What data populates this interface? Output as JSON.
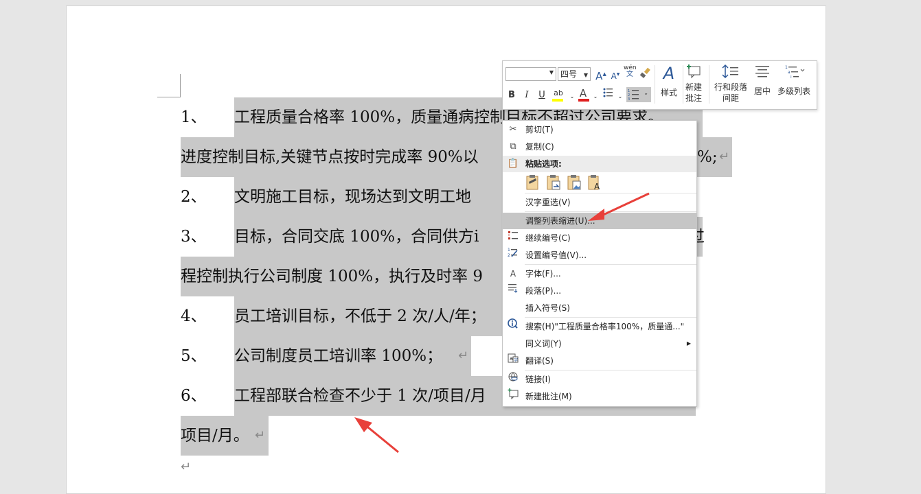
{
  "document": {
    "items": [
      {
        "num": "1、",
        "text": "工程质量合格率 100%，质量通病控制目标不超过公司要求。"
      },
      {
        "cont": "进度控制目标,关键节点按时完成率 90%以",
        "tail": "%;"
      },
      {
        "num": "2、",
        "text": "文明施工目标，现场达到文明工地"
      },
      {
        "num": "3、",
        "text": "目标，合同交底 100%，合同供方i",
        "tail": "过"
      },
      {
        "cont": "程控制执行公司制度 100%，执行及时率 9"
      },
      {
        "num": "4、",
        "text": "员工培训目标，不低于 2 次/人/年；"
      },
      {
        "num": "5、",
        "text": "公司制度员工培训率 100%；"
      },
      {
        "num": "6、",
        "text": "工程部联合检查不少于 1 次/项目/月"
      },
      {
        "cont": "项目/月。"
      }
    ],
    "para_mark": "↵"
  },
  "mini_toolbar": {
    "font_name": "",
    "font_size": "四号",
    "grow_font": "A",
    "shrink_font": "A",
    "phonetic_top": "wén",
    "phonetic_bottom": "文",
    "bold": "B",
    "italic": "I",
    "underline": "U",
    "highlight": "ab",
    "font_color": "A",
    "styles_label": "样式",
    "new_comment_label_1": "新建",
    "new_comment_label_2": "批注",
    "line_spacing_label_1": "行和段落",
    "line_spacing_label_2": "间距",
    "center_label": "居中",
    "multilevel_label": "多级列表"
  },
  "context_menu": {
    "cut": "剪切(T)",
    "copy": "复制(C)",
    "paste_options": "粘贴选项:",
    "hanzi_reselect": "汉字重选(V)",
    "adjust_list_indent": "调整列表缩进(U)...",
    "continue_numbering": "继续编号(C)",
    "set_numbering_value": "设置编号值(V)...",
    "font": "字体(F)...",
    "paragraph": "段落(P)...",
    "insert_symbol": "插入符号(S)",
    "search": "搜索(H)\"工程质量合格率100%，质量通...\"",
    "synonyms": "同义词(Y)",
    "translate": "翻译(S)",
    "link": "链接(I)",
    "new_comment": "新建批注(M)"
  },
  "colors": {
    "selection": "#c8c8c8",
    "arrow": "#e8403a",
    "menu_hover": "#c6c6c6",
    "font_color_red": "#e02020",
    "highlight_yellow": "#ffff00"
  }
}
